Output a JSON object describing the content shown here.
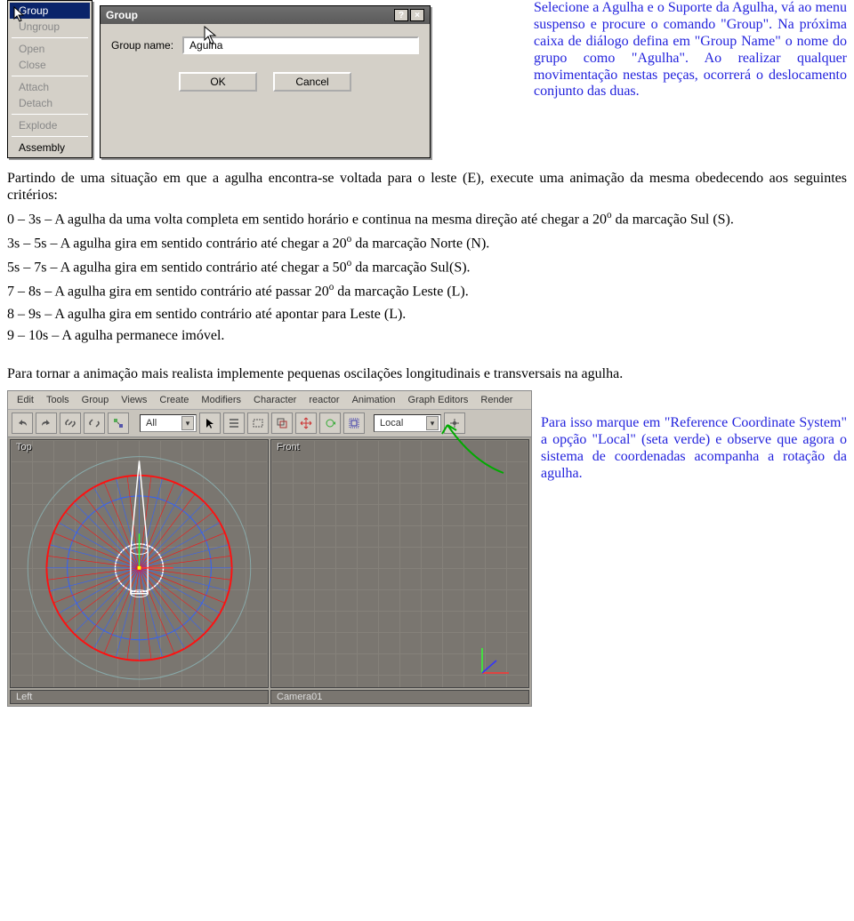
{
  "context_menu": {
    "items": [
      {
        "label": "Group",
        "enabled": true,
        "highlight": true,
        "name": "ctx-group"
      },
      {
        "label": "Ungroup",
        "enabled": false,
        "name": "ctx-ungroup"
      },
      {
        "label": "Open",
        "enabled": false,
        "name": "ctx-open"
      },
      {
        "label": "Close",
        "enabled": false,
        "name": "ctx-close"
      },
      {
        "label": "Attach",
        "enabled": false,
        "name": "ctx-attach"
      },
      {
        "label": "Detach",
        "enabled": false,
        "name": "ctx-detach"
      },
      {
        "label": "Explode",
        "enabled": false,
        "name": "ctx-explode"
      },
      {
        "label": "Assembly",
        "enabled": true,
        "name": "ctx-assembly"
      }
    ]
  },
  "dialog": {
    "title": "Group",
    "help_glyph": "?",
    "close_glyph": "×",
    "name_label": "Group name:",
    "name_value": "Agulha",
    "ok_label": "OK",
    "cancel_label": "Cancel"
  },
  "text": {
    "p1": "Selecione a Agulha e o Suporte da Agulha, vá ao menu suspenso e procure o comando \"Group\". Na próxima caixa de diálogo defina em \"Group Name\" o nome do grupo como \"Agulha\". Ao realizar qualquer movimentação nestas peças, ocorrerá o deslocamento conjunto das duas.",
    "p2_intro": "Partindo de uma situação em que a agulha encontra-se voltada para  o leste (E), execute uma animação da mesma obedecendo aos seguintes critérios:",
    "b1a": "0 – 3s – A agulha da uma volta completa em sentido horário e continua na mesma direção até chegar a 20",
    "deg": "o",
    "b1b": " da marcação Sul (S).",
    "b2a": "3s – 5s – A agulha gira em sentido contrário até chegar a 20",
    "b2b": " da marcação Norte (N).",
    "b3a": "5s – 7s – A agulha gira em sentido contrário até chegar a 50",
    "b3b": " da marcação Sul(S).",
    "b4a": "7 – 8s – A agulha gira em sentido contrário até passar 20",
    "b4b": "  da marcação Leste (L).",
    "b5": "8 – 9s – A agulha gira em sentido contrário até apontar para Leste (L).",
    "b6": "9 – 10s – A agulha permanece imóvel.",
    "p3": "Para tornar a animação mais realista implemente pequenas oscilações longitudinais e transversais na agulha.",
    "p4": "Para isso marque em \"Reference Coordinate System\" a opção \"Local\" (seta verde) e observe que agora o sistema de coordenadas acompanha a rotação da agulha."
  },
  "max_ui": {
    "menus": [
      "Edit",
      "Tools",
      "Group",
      "Views",
      "Create",
      "Modifiers",
      "Character",
      "reactor",
      "Animation",
      "Graph Editors",
      "Render"
    ],
    "selection_set": "All",
    "coord_system": "Local",
    "viewports": {
      "top": "Top",
      "front": "Front",
      "left": "Left",
      "camera": "Camera01"
    }
  },
  "colors": {
    "blue_text": "#2323dd",
    "compass_blue": "#3060ff",
    "compass_red": "#ff1010",
    "ui_grey": "#d4d0c8"
  }
}
